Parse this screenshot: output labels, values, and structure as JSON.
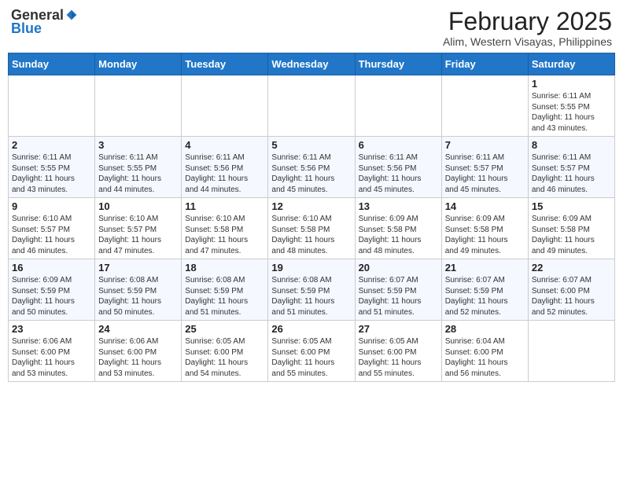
{
  "header": {
    "logo": {
      "general": "General",
      "blue": "Blue"
    },
    "title": "February 2025",
    "location": "Alim, Western Visayas, Philippines"
  },
  "weekdays": [
    "Sunday",
    "Monday",
    "Tuesday",
    "Wednesday",
    "Thursday",
    "Friday",
    "Saturday"
  ],
  "weeks": [
    [
      {
        "day": "",
        "info": ""
      },
      {
        "day": "",
        "info": ""
      },
      {
        "day": "",
        "info": ""
      },
      {
        "day": "",
        "info": ""
      },
      {
        "day": "",
        "info": ""
      },
      {
        "day": "",
        "info": ""
      },
      {
        "day": "1",
        "info": "Sunrise: 6:11 AM\nSunset: 5:55 PM\nDaylight: 11 hours\nand 43 minutes."
      }
    ],
    [
      {
        "day": "2",
        "info": "Sunrise: 6:11 AM\nSunset: 5:55 PM\nDaylight: 11 hours\nand 43 minutes."
      },
      {
        "day": "3",
        "info": "Sunrise: 6:11 AM\nSunset: 5:55 PM\nDaylight: 11 hours\nand 44 minutes."
      },
      {
        "day": "4",
        "info": "Sunrise: 6:11 AM\nSunset: 5:56 PM\nDaylight: 11 hours\nand 44 minutes."
      },
      {
        "day": "5",
        "info": "Sunrise: 6:11 AM\nSunset: 5:56 PM\nDaylight: 11 hours\nand 45 minutes."
      },
      {
        "day": "6",
        "info": "Sunrise: 6:11 AM\nSunset: 5:56 PM\nDaylight: 11 hours\nand 45 minutes."
      },
      {
        "day": "7",
        "info": "Sunrise: 6:11 AM\nSunset: 5:57 PM\nDaylight: 11 hours\nand 45 minutes."
      },
      {
        "day": "8",
        "info": "Sunrise: 6:11 AM\nSunset: 5:57 PM\nDaylight: 11 hours\nand 46 minutes."
      }
    ],
    [
      {
        "day": "9",
        "info": "Sunrise: 6:10 AM\nSunset: 5:57 PM\nDaylight: 11 hours\nand 46 minutes."
      },
      {
        "day": "10",
        "info": "Sunrise: 6:10 AM\nSunset: 5:57 PM\nDaylight: 11 hours\nand 47 minutes."
      },
      {
        "day": "11",
        "info": "Sunrise: 6:10 AM\nSunset: 5:58 PM\nDaylight: 11 hours\nand 47 minutes."
      },
      {
        "day": "12",
        "info": "Sunrise: 6:10 AM\nSunset: 5:58 PM\nDaylight: 11 hours\nand 48 minutes."
      },
      {
        "day": "13",
        "info": "Sunrise: 6:09 AM\nSunset: 5:58 PM\nDaylight: 11 hours\nand 48 minutes."
      },
      {
        "day": "14",
        "info": "Sunrise: 6:09 AM\nSunset: 5:58 PM\nDaylight: 11 hours\nand 49 minutes."
      },
      {
        "day": "15",
        "info": "Sunrise: 6:09 AM\nSunset: 5:58 PM\nDaylight: 11 hours\nand 49 minutes."
      }
    ],
    [
      {
        "day": "16",
        "info": "Sunrise: 6:09 AM\nSunset: 5:59 PM\nDaylight: 11 hours\nand 50 minutes."
      },
      {
        "day": "17",
        "info": "Sunrise: 6:08 AM\nSunset: 5:59 PM\nDaylight: 11 hours\nand 50 minutes."
      },
      {
        "day": "18",
        "info": "Sunrise: 6:08 AM\nSunset: 5:59 PM\nDaylight: 11 hours\nand 51 minutes."
      },
      {
        "day": "19",
        "info": "Sunrise: 6:08 AM\nSunset: 5:59 PM\nDaylight: 11 hours\nand 51 minutes."
      },
      {
        "day": "20",
        "info": "Sunrise: 6:07 AM\nSunset: 5:59 PM\nDaylight: 11 hours\nand 51 minutes."
      },
      {
        "day": "21",
        "info": "Sunrise: 6:07 AM\nSunset: 5:59 PM\nDaylight: 11 hours\nand 52 minutes."
      },
      {
        "day": "22",
        "info": "Sunrise: 6:07 AM\nSunset: 6:00 PM\nDaylight: 11 hours\nand 52 minutes."
      }
    ],
    [
      {
        "day": "23",
        "info": "Sunrise: 6:06 AM\nSunset: 6:00 PM\nDaylight: 11 hours\nand 53 minutes."
      },
      {
        "day": "24",
        "info": "Sunrise: 6:06 AM\nSunset: 6:00 PM\nDaylight: 11 hours\nand 53 minutes."
      },
      {
        "day": "25",
        "info": "Sunrise: 6:05 AM\nSunset: 6:00 PM\nDaylight: 11 hours\nand 54 minutes."
      },
      {
        "day": "26",
        "info": "Sunrise: 6:05 AM\nSunset: 6:00 PM\nDaylight: 11 hours\nand 55 minutes."
      },
      {
        "day": "27",
        "info": "Sunrise: 6:05 AM\nSunset: 6:00 PM\nDaylight: 11 hours\nand 55 minutes."
      },
      {
        "day": "28",
        "info": "Sunrise: 6:04 AM\nSunset: 6:00 PM\nDaylight: 11 hours\nand 56 minutes."
      },
      {
        "day": "",
        "info": ""
      }
    ]
  ]
}
